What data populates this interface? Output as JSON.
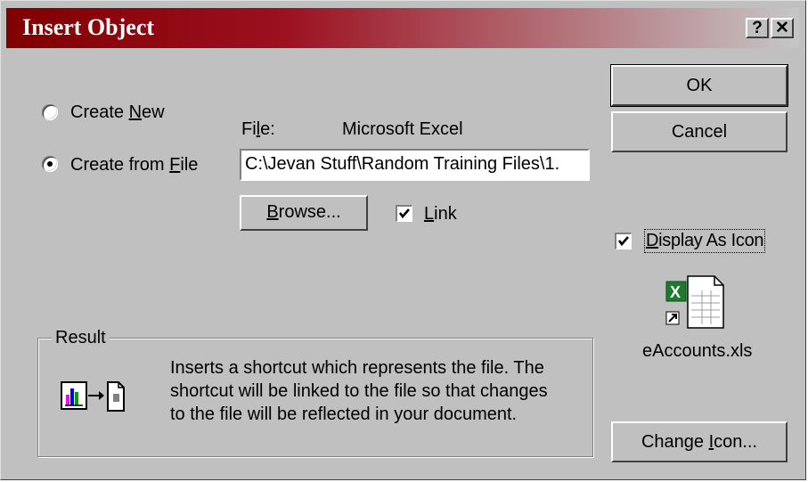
{
  "dialog": {
    "title": "Insert Object",
    "help_label": "?",
    "close_label": "✕"
  },
  "options": {
    "create_new": {
      "pre": "Create ",
      "accel": "N",
      "post": "ew",
      "selected": false
    },
    "create_from_file": {
      "pre": "Create from ",
      "accel": "F",
      "post": "ile",
      "selected": true
    }
  },
  "file": {
    "label_pre": "Fi",
    "label_accel": "l",
    "label_post": "e:",
    "app_name": "Microsoft Excel",
    "path_value": "C:\\Jevan Stuff\\Random Training Files\\1."
  },
  "browse": {
    "accel": "B",
    "post": "rowse..."
  },
  "link": {
    "accel": "L",
    "post": "ink",
    "checked": true
  },
  "buttons": {
    "ok": "OK",
    "cancel": "Cancel",
    "change_icon": {
      "pre": "Change ",
      "accel": "I",
      "post": "con..."
    }
  },
  "display_as_icon": {
    "pre": "",
    "accel": "D",
    "post": "isplay As Icon",
    "checked": true
  },
  "icon_preview": {
    "caption": "eAccounts.xls",
    "icon": "excel-file-shortcut-icon"
  },
  "result": {
    "label": "Result",
    "line1": "Inserts a shortcut which represents the file.  The",
    "line2": "shortcut will be linked to the file so that changes",
    "line3": "to the file will be reflected in your document.",
    "icon": "object-to-document-link-icon"
  },
  "colors": {
    "face": "#c0c0c0",
    "title_start": "#800000",
    "title_end": "#c6c6c6"
  }
}
